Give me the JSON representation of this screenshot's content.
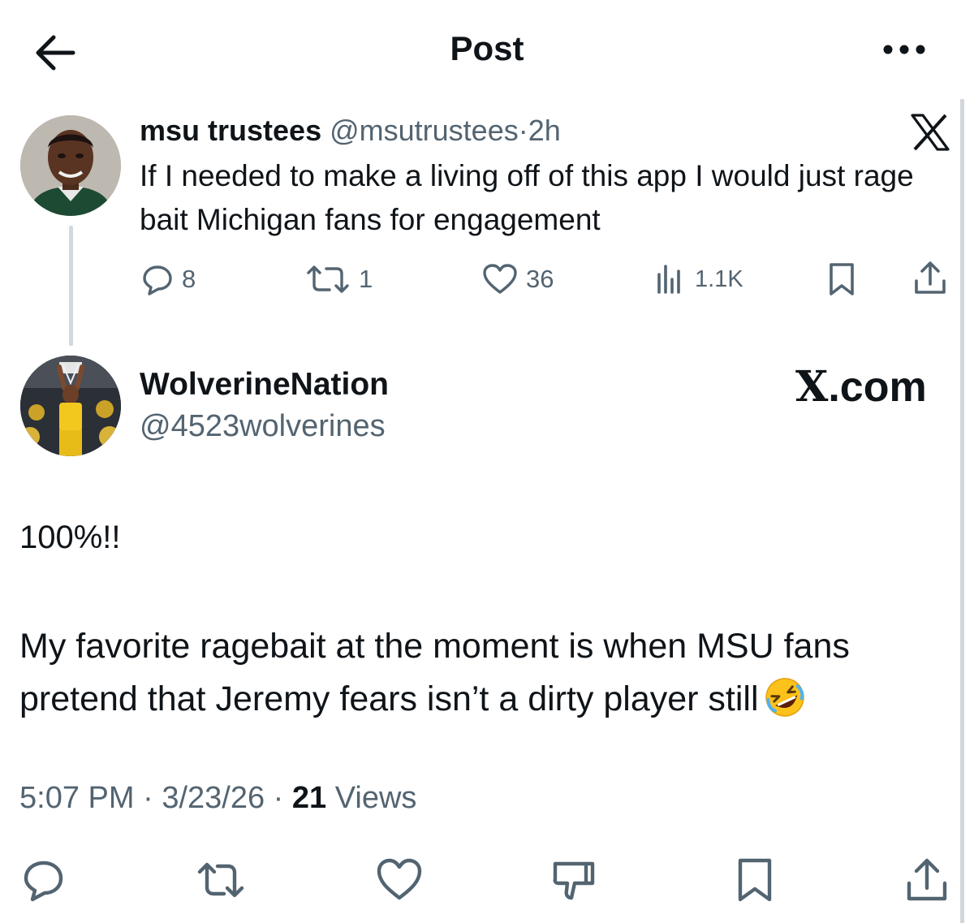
{
  "header": {
    "title": "Post",
    "back_icon": "arrow-left-icon",
    "more_icon": "more-horizontal-icon"
  },
  "quoted_post": {
    "display_name": "msu trustees",
    "handle": "@msutrustees",
    "separator": "·",
    "age": "2h",
    "text": "If I needed to make a living off of this app I would just rage bait Michigan fans for engagement",
    "replies": "8",
    "reposts": "1",
    "likes": "36",
    "views": "1.1K",
    "brand_icon": "x-logo-icon"
  },
  "main_post": {
    "display_name": "WolverineNation",
    "handle": "@4523wolverines",
    "watermark_x": "X",
    "watermark_domain": ".com",
    "line1": "100%!!",
    "body": "My favorite ragebait at the moment is when MSU fans pretend that Jeremy fears isn’t a dirty player still",
    "emoji": "rolling-on-floor-laughing-emoji",
    "time": "5:07 PM",
    "date": "3/23/26",
    "dot": "·",
    "views_count": "21",
    "views_label": "Views"
  },
  "action_bar": [
    "reply-icon",
    "repost-icon",
    "like-icon",
    "dislike-icon",
    "bookmark-icon",
    "share-icon"
  ],
  "colors": {
    "text": "#0f1419",
    "secondary": "#536471",
    "thread_line": "#cfd9de",
    "background": "#ffffff"
  }
}
